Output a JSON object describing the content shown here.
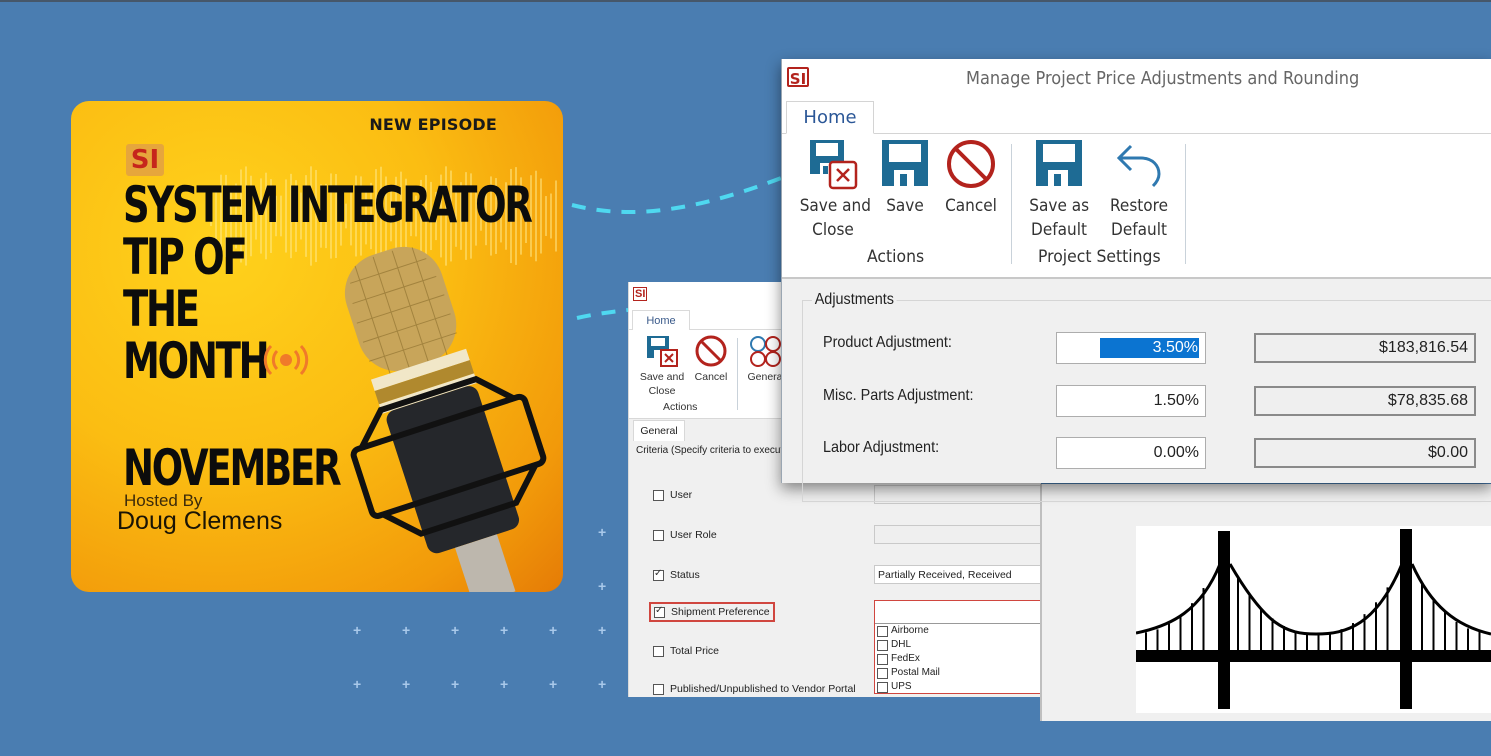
{
  "background": {
    "color": "#4a7db1",
    "accent_dash_color": "#4fd8f0"
  },
  "podcast_card": {
    "badge": "NEW EPISODE",
    "logo_text": "SI",
    "title_lines": [
      "SYSTEM INTEGRATOR",
      "TIP OF",
      "THE",
      "MONTH"
    ],
    "broadcast_icon": "broadcast-icon",
    "month": "NOVEMBER",
    "hosted_by_label": "Hosted By",
    "host_name": "Doug Clemens",
    "image": "microphone-image",
    "colors": {
      "bg_light": "#ffd21c",
      "bg_dark": "#e57b06",
      "logo_red": "#c6261c",
      "broadcast": "#f07a2a"
    }
  },
  "main_window": {
    "logo_text": "SI",
    "title": "Manage Project Price Adjustments and Rounding",
    "tabs": [
      {
        "label": "Home",
        "active": true
      }
    ],
    "ribbon_groups": [
      {
        "label": "Actions",
        "buttons": [
          {
            "label_line1": "Save and",
            "label_line2": "Close",
            "icon": "save-close-icon"
          },
          {
            "label_line1": "Save",
            "label_line2": "",
            "icon": "save-icon"
          },
          {
            "label_line1": "Cancel",
            "label_line2": "",
            "icon": "cancel-icon"
          }
        ]
      },
      {
        "label": "Project Settings",
        "buttons": [
          {
            "label_line1": "Save as",
            "label_line2": "Default",
            "icon": "save-default-icon"
          },
          {
            "label_line1": "Restore",
            "label_line2": "Default",
            "icon": "undo-icon"
          }
        ]
      }
    ],
    "adjustments": {
      "legend": "Adjustments",
      "rows": [
        {
          "label": "Product Adjustment:",
          "percent": "3.50%",
          "amount": "$183,816.54",
          "selected": true
        },
        {
          "label": "Misc. Parts Adjustment:",
          "percent": "1.50%",
          "amount": "$78,835.68",
          "selected": false
        },
        {
          "label": "Labor Adjustment:",
          "percent": "0.00%",
          "amount": "$0.00",
          "selected": false
        }
      ]
    },
    "colors": {
      "icon_blue": "#1e6b94",
      "icon_red": "#b3231d",
      "selection": "#0b74d1",
      "tab_text": "#2b5797"
    }
  },
  "criteria_window": {
    "logo_text": "SI",
    "tabs": [
      {
        "label": "Home",
        "active": true
      }
    ],
    "ribbon_buttons": [
      {
        "label_line1": "Save and",
        "label_line2": "Close",
        "icon": "save-close-icon"
      },
      {
        "label_line1": "Cancel",
        "label_line2": "",
        "icon": "cancel-icon"
      },
      {
        "label_line1": "Genera",
        "label_line2": "",
        "icon": "general-circles-icon"
      }
    ],
    "group_label": "Actions",
    "sub_tabs": [
      {
        "label": "General"
      }
    ],
    "criteria_text": "Criteria (Specify criteria to execut",
    "criteria_rows": [
      {
        "label": "User",
        "checked": false,
        "value": ""
      },
      {
        "label": "User Role",
        "checked": false,
        "value": ""
      },
      {
        "label": "Status",
        "checked": true,
        "value": "Partially Received, Received"
      },
      {
        "label": "Shipment Preference",
        "checked": true,
        "value": "",
        "highlighted": true
      },
      {
        "label": "Total Price",
        "checked": false,
        "value": ""
      },
      {
        "label": "Published/Unpublished to Vendor Portal",
        "checked": false,
        "value": ""
      }
    ],
    "shipment_options": [
      {
        "label": "Airborne",
        "checked": false
      },
      {
        "label": "DHL",
        "checked": false
      },
      {
        "label": "FedEx",
        "checked": false
      },
      {
        "label": "Postal Mail",
        "checked": false
      },
      {
        "label": "UPS",
        "checked": false
      }
    ],
    "colors": {
      "highlight_red": "#d0463f"
    }
  },
  "bridge_panel": {
    "image": "suspension-bridge-image"
  }
}
